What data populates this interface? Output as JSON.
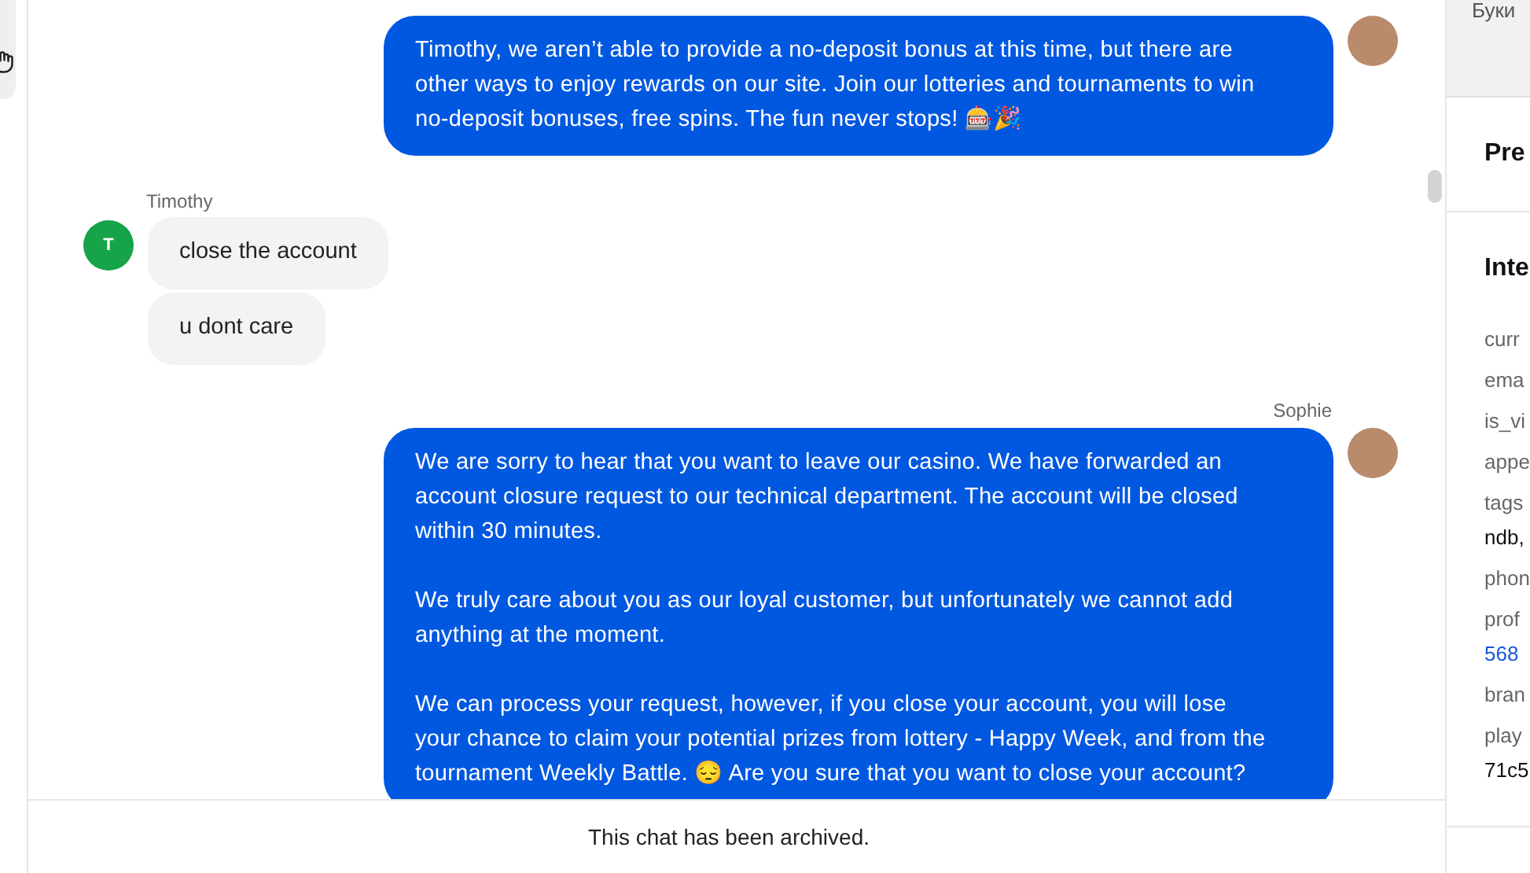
{
  "messages": [
    {
      "kind": "agent",
      "paragraphs": [
        "Timothy, we aren’t able to provide a no-deposit bonus at this time, but there are other ways to enjoy rewards on our site. Join our lotteries and tournaments to win no-deposit bonuses, free spins. The fun never stops! 🎰🎉"
      ]
    },
    {
      "kind": "customer",
      "name": "Timothy",
      "avatar_letter": "T",
      "bubbles": [
        "close the account",
        "u dont care"
      ]
    },
    {
      "kind": "agent",
      "name": "Sophie",
      "paragraphs": [
        "We are sorry to hear that you want to leave our casino. We have forwarded an account closure request to our technical department. The account will be closed within 30 minutes.",
        "We truly care about you as our loyal customer, but unfortunately we cannot add anything at the moment.",
        "We can process your request, however, if you close your account, you will lose your chance to claim your potential prizes from lottery - Happy Week, and from the tournament Weekly Battle. 😔 Are you sure that you want to close your account?"
      ]
    }
  ],
  "archived_notice": "This chat has been archived.",
  "side_panel": {
    "map_label": "Буки",
    "sections": [
      {
        "title": "Pre"
      },
      {
        "title": "Inte",
        "fields": [
          {
            "label": "curr"
          },
          {
            "label": "ema"
          },
          {
            "label": "is_vi"
          },
          {
            "label": "appe"
          },
          {
            "label": "tags",
            "value": "ndb,"
          },
          {
            "label": "phon"
          },
          {
            "label": "prof",
            "value": "568",
            "link": true
          },
          {
            "label": "bran"
          },
          {
            "label": "play",
            "value": "71c5"
          }
        ]
      }
    ]
  }
}
